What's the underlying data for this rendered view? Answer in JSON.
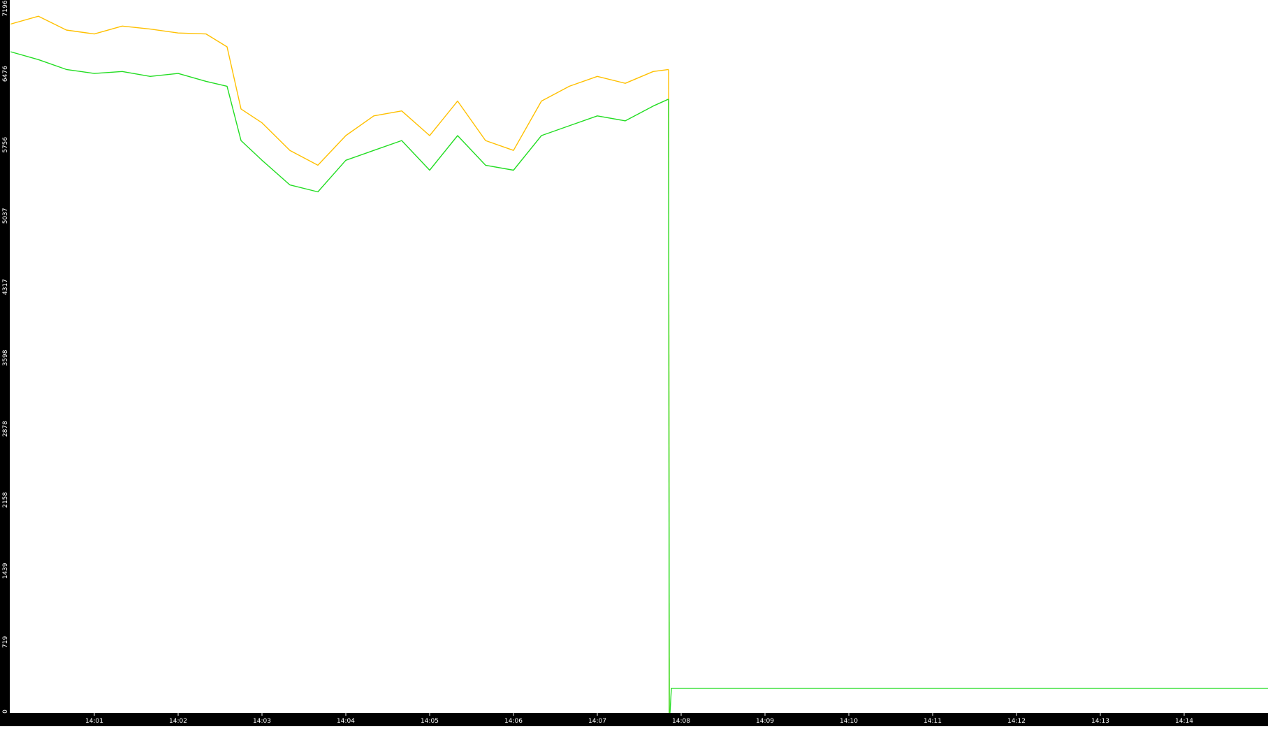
{
  "chart_data": {
    "type": "line",
    "title": "",
    "xlabel": "",
    "ylabel": "",
    "ylim": [
      0,
      7196
    ],
    "xlim": [
      "14:00",
      "14:15"
    ],
    "grid": false,
    "legend": "none",
    "y_ticks": [
      "0",
      "719",
      "1439",
      "2158",
      "2878",
      "3598",
      "4317",
      "5037",
      "5756",
      "6476",
      "7196"
    ],
    "x_ticks": [
      "14:01",
      "14:02",
      "14:03",
      "14:04",
      "14:05",
      "14:06",
      "14:07",
      "14:08",
      "14:09",
      "14:10",
      "14:11",
      "14:12",
      "14:13",
      "14:14"
    ],
    "series": [
      {
        "color": "#ffc000",
        "x": [
          "14:00:00",
          "14:00:20",
          "14:00:40",
          "14:01:00",
          "14:01:20",
          "14:01:40",
          "14:02:00",
          "14:02:20",
          "14:02:35",
          "14:02:45",
          "14:03:00",
          "14:03:20",
          "14:03:40",
          "14:04:00",
          "14:04:20",
          "14:04:40",
          "14:05:00",
          "14:05:20",
          "14:05:40",
          "14:06:00",
          "14:06:20",
          "14:06:40",
          "14:07:00",
          "14:07:20",
          "14:07:40",
          "14:07:51"
        ],
        "y": [
          6980,
          7060,
          6920,
          6880,
          6960,
          6930,
          6890,
          6880,
          6750,
          6120,
          5980,
          5700,
          5550,
          5850,
          6050,
          6100,
          5850,
          6200,
          5800,
          5700,
          6200,
          6350,
          6450,
          6380,
          6500,
          6520
        ]
      },
      {
        "color": "#22dd22",
        "x": [
          "14:00:00",
          "14:00:20",
          "14:00:40",
          "14:01:00",
          "14:01:20",
          "14:01:40",
          "14:02:00",
          "14:02:20",
          "14:02:35",
          "14:02:45",
          "14:03:00",
          "14:03:20",
          "14:03:40",
          "14:04:00",
          "14:04:20",
          "14:04:40",
          "14:05:00",
          "14:05:20",
          "14:05:40",
          "14:06:00",
          "14:06:20",
          "14:06:40",
          "14:07:00",
          "14:07:20",
          "14:07:40",
          "14:07:51"
        ],
        "y": [
          6700,
          6620,
          6520,
          6480,
          6500,
          6450,
          6480,
          6400,
          6350,
          5800,
          5600,
          5350,
          5280,
          5600,
          5700,
          5800,
          5500,
          5850,
          5550,
          5500,
          5850,
          5950,
          6050,
          6000,
          6150,
          6220
        ]
      },
      {
        "color": "#22dd22",
        "x": [
          "14:07:52",
          "14:07:53",
          "14:15:00"
        ],
        "y": [
          0,
          250,
          250
        ]
      }
    ]
  }
}
